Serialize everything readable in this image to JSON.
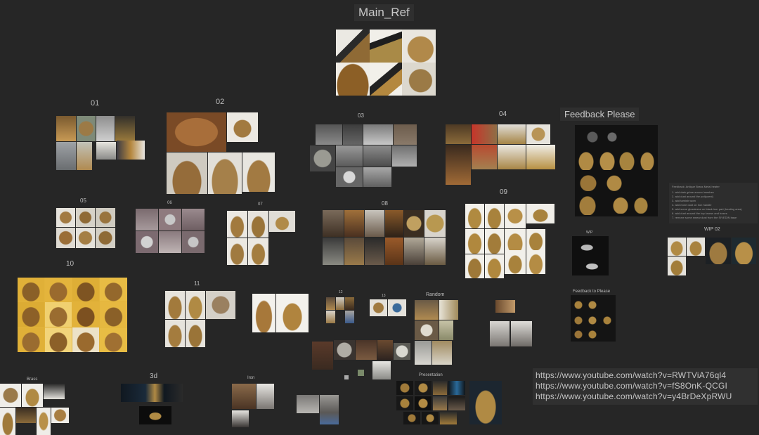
{
  "board": {
    "title": "Main_Ref",
    "group_labels": {
      "g01": "01",
      "g02": "02",
      "g03": "03",
      "g04": "04",
      "g05": "05",
      "g06": "06",
      "g07": "07",
      "g08": "08",
      "g09": "09",
      "g10": "10",
      "g11": "11",
      "g12": "12",
      "g13": "13",
      "random": "Random",
      "brass": "Brass",
      "threed": "3d",
      "iron": "Iron",
      "presentation": "Presentation",
      "feedback": "Feedback Please",
      "feedback_small": "Feedback to Please",
      "wip": "WIP",
      "wip02": "WIP 02"
    },
    "feedback_note": {
      "title": "Feedback: Antique Brass Metal heater",
      "lines": [
        "1. add dark grime around meshes",
        "2. add dust around the pot(scent)",
        "3. add tarnish worn",
        "4. add more dust on iron handle",
        "5. add some glossiness on black iron part (heating area)",
        "6. add dust around the top knows and hoses",
        "7. remove some smear dust from the SIVEDIN base"
      ]
    },
    "links": [
      "https://www.youtube.com/watch?v=RWTViA76ql4",
      "https://www.youtube.com/watch?v=fS8OnK-QCGI",
      "https://www.youtube.com/watch?v=y4BrDeXpRWU"
    ],
    "colors": {
      "background": "#262626",
      "brass": "#a77a3a",
      "dark_brass": "#6b4a24",
      "white_bg": "#e8e6e0",
      "black_bg": "#121212",
      "yellow_bg": "#e2b33a"
    }
  }
}
